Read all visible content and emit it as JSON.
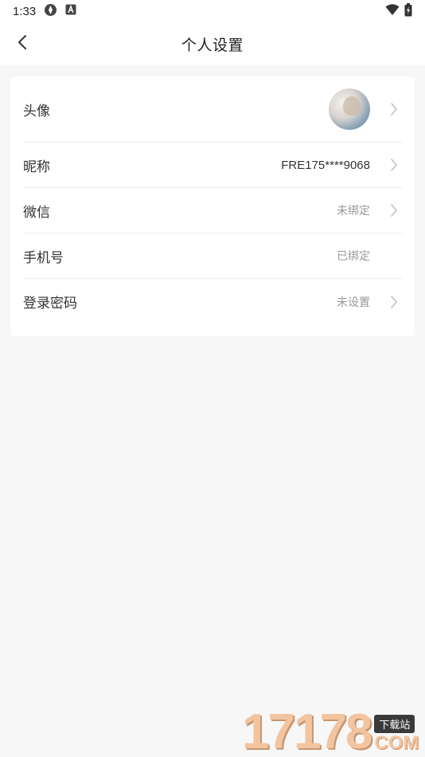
{
  "status_bar": {
    "time": "1:33",
    "icons": [
      "sync-icon",
      "a-badge-icon",
      "wifi-icon",
      "battery-icon"
    ]
  },
  "nav": {
    "title": "个人设置",
    "back_icon": "chevron-left-icon"
  },
  "settings": {
    "avatar": {
      "label": "头像"
    },
    "nickname": {
      "label": "昵称",
      "value": "FRE175****9068"
    },
    "wechat": {
      "label": "微信",
      "value": "未绑定"
    },
    "phone": {
      "label": "手机号",
      "value": "已绑定"
    },
    "password": {
      "label": "登录密码",
      "value": "未设置"
    }
  },
  "watermark": {
    "number": "17178",
    "tag": "下载站",
    "domain": "COM"
  },
  "colors": {
    "background": "#f7f7f7",
    "card": "#ffffff",
    "muted_text": "#999999",
    "divider": "#ececec"
  }
}
